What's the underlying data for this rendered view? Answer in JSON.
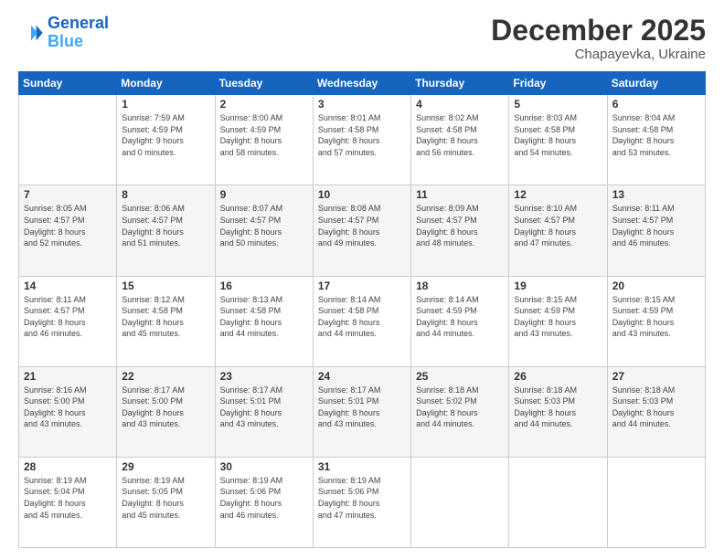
{
  "logo": {
    "line1": "General",
    "line2": "Blue"
  },
  "header": {
    "month": "December 2025",
    "location": "Chapayevka, Ukraine"
  },
  "weekdays": [
    "Sunday",
    "Monday",
    "Tuesday",
    "Wednesday",
    "Thursday",
    "Friday",
    "Saturday"
  ],
  "weeks": [
    [
      {
        "day": "",
        "info": ""
      },
      {
        "day": "1",
        "info": "Sunrise: 7:59 AM\nSunset: 4:59 PM\nDaylight: 9 hours\nand 0 minutes."
      },
      {
        "day": "2",
        "info": "Sunrise: 8:00 AM\nSunset: 4:59 PM\nDaylight: 8 hours\nand 58 minutes."
      },
      {
        "day": "3",
        "info": "Sunrise: 8:01 AM\nSunset: 4:58 PM\nDaylight: 8 hours\nand 57 minutes."
      },
      {
        "day": "4",
        "info": "Sunrise: 8:02 AM\nSunset: 4:58 PM\nDaylight: 8 hours\nand 56 minutes."
      },
      {
        "day": "5",
        "info": "Sunrise: 8:03 AM\nSunset: 4:58 PM\nDaylight: 8 hours\nand 54 minutes."
      },
      {
        "day": "6",
        "info": "Sunrise: 8:04 AM\nSunset: 4:58 PM\nDaylight: 8 hours\nand 53 minutes."
      }
    ],
    [
      {
        "day": "7",
        "info": "Sunrise: 8:05 AM\nSunset: 4:57 PM\nDaylight: 8 hours\nand 52 minutes."
      },
      {
        "day": "8",
        "info": "Sunrise: 8:06 AM\nSunset: 4:57 PM\nDaylight: 8 hours\nand 51 minutes."
      },
      {
        "day": "9",
        "info": "Sunrise: 8:07 AM\nSunset: 4:57 PM\nDaylight: 8 hours\nand 50 minutes."
      },
      {
        "day": "10",
        "info": "Sunrise: 8:08 AM\nSunset: 4:57 PM\nDaylight: 8 hours\nand 49 minutes."
      },
      {
        "day": "11",
        "info": "Sunrise: 8:09 AM\nSunset: 4:57 PM\nDaylight: 8 hours\nand 48 minutes."
      },
      {
        "day": "12",
        "info": "Sunrise: 8:10 AM\nSunset: 4:57 PM\nDaylight: 8 hours\nand 47 minutes."
      },
      {
        "day": "13",
        "info": "Sunrise: 8:11 AM\nSunset: 4:57 PM\nDaylight: 8 hours\nand 46 minutes."
      }
    ],
    [
      {
        "day": "14",
        "info": "Sunrise: 8:11 AM\nSunset: 4:57 PM\nDaylight: 8 hours\nand 46 minutes."
      },
      {
        "day": "15",
        "info": "Sunrise: 8:12 AM\nSunset: 4:58 PM\nDaylight: 8 hours\nand 45 minutes."
      },
      {
        "day": "16",
        "info": "Sunrise: 8:13 AM\nSunset: 4:58 PM\nDaylight: 8 hours\nand 44 minutes."
      },
      {
        "day": "17",
        "info": "Sunrise: 8:14 AM\nSunset: 4:58 PM\nDaylight: 8 hours\nand 44 minutes."
      },
      {
        "day": "18",
        "info": "Sunrise: 8:14 AM\nSunset: 4:59 PM\nDaylight: 8 hours\nand 44 minutes."
      },
      {
        "day": "19",
        "info": "Sunrise: 8:15 AM\nSunset: 4:59 PM\nDaylight: 8 hours\nand 43 minutes."
      },
      {
        "day": "20",
        "info": "Sunrise: 8:15 AM\nSunset: 4:59 PM\nDaylight: 8 hours\nand 43 minutes."
      }
    ],
    [
      {
        "day": "21",
        "info": "Sunrise: 8:16 AM\nSunset: 5:00 PM\nDaylight: 8 hours\nand 43 minutes."
      },
      {
        "day": "22",
        "info": "Sunrise: 8:17 AM\nSunset: 5:00 PM\nDaylight: 8 hours\nand 43 minutes."
      },
      {
        "day": "23",
        "info": "Sunrise: 8:17 AM\nSunset: 5:01 PM\nDaylight: 8 hours\nand 43 minutes."
      },
      {
        "day": "24",
        "info": "Sunrise: 8:17 AM\nSunset: 5:01 PM\nDaylight: 8 hours\nand 43 minutes."
      },
      {
        "day": "25",
        "info": "Sunrise: 8:18 AM\nSunset: 5:02 PM\nDaylight: 8 hours\nand 44 minutes."
      },
      {
        "day": "26",
        "info": "Sunrise: 8:18 AM\nSunset: 5:03 PM\nDaylight: 8 hours\nand 44 minutes."
      },
      {
        "day": "27",
        "info": "Sunrise: 8:18 AM\nSunset: 5:03 PM\nDaylight: 8 hours\nand 44 minutes."
      }
    ],
    [
      {
        "day": "28",
        "info": "Sunrise: 8:19 AM\nSunset: 5:04 PM\nDaylight: 8 hours\nand 45 minutes."
      },
      {
        "day": "29",
        "info": "Sunrise: 8:19 AM\nSunset: 5:05 PM\nDaylight: 8 hours\nand 45 minutes."
      },
      {
        "day": "30",
        "info": "Sunrise: 8:19 AM\nSunset: 5:06 PM\nDaylight: 8 hours\nand 46 minutes."
      },
      {
        "day": "31",
        "info": "Sunrise: 8:19 AM\nSunset: 5:06 PM\nDaylight: 8 hours\nand 47 minutes."
      },
      {
        "day": "",
        "info": ""
      },
      {
        "day": "",
        "info": ""
      },
      {
        "day": "",
        "info": ""
      }
    ]
  ]
}
